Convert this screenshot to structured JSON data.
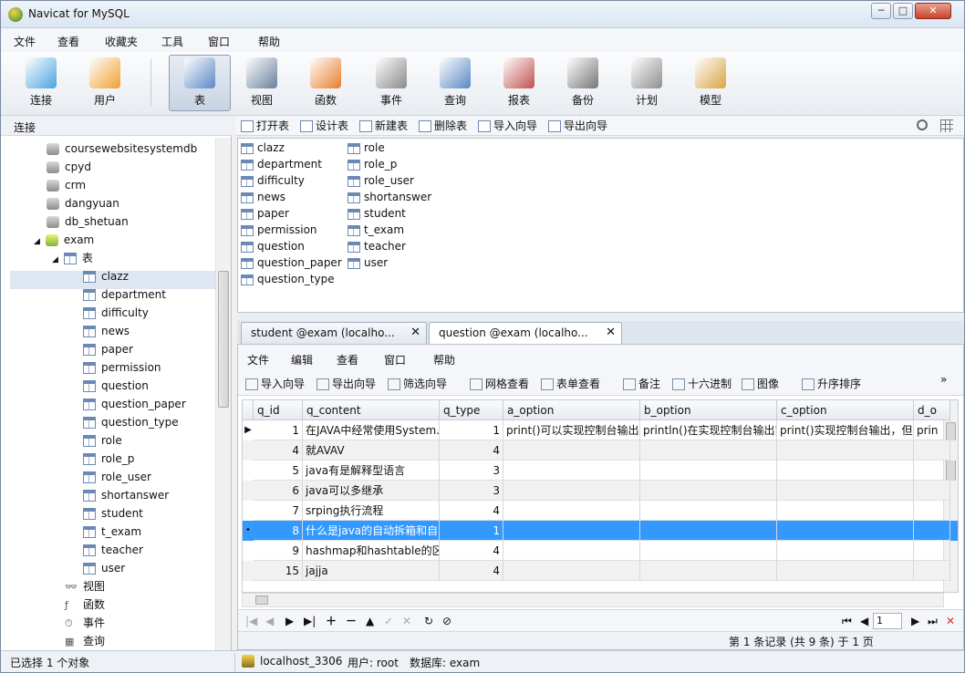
{
  "window": {
    "title": "Navicat for MySQL",
    "min": "─",
    "max": "□",
    "close": "✕"
  },
  "menu": [
    "文件",
    "查看",
    "收藏夹",
    "工具",
    "窗口",
    "帮助"
  ],
  "toolbar": [
    {
      "label": "连接",
      "icon": "connection-icon",
      "color": "#4aa3df"
    },
    {
      "label": "用户",
      "icon": "user-icon",
      "color": "#f0a030"
    },
    {
      "label": "表",
      "icon": "table-icon",
      "color": "#5b87c5",
      "active": true
    },
    {
      "label": "视图",
      "icon": "view-icon",
      "color": "#6a7f9c"
    },
    {
      "label": "函数",
      "icon": "function-icon",
      "color": "#e87d2a"
    },
    {
      "label": "事件",
      "icon": "event-icon",
      "color": "#8a8a8a"
    },
    {
      "label": "查询",
      "icon": "query-icon",
      "color": "#5b87c5"
    },
    {
      "label": "报表",
      "icon": "report-icon",
      "color": "#c0504d"
    },
    {
      "label": "备份",
      "icon": "backup-icon",
      "color": "#777777"
    },
    {
      "label": "计划",
      "icon": "schedule-icon",
      "color": "#8f8f8f"
    },
    {
      "label": "模型",
      "icon": "model-icon",
      "color": "#d9a441"
    }
  ],
  "left_panel": {
    "header": "连接"
  },
  "tree": {
    "databases": [
      "coursewebsitesystemdb",
      "cpyd",
      "crm",
      "dangyuan",
      "db_shetuan"
    ],
    "open_db": "exam",
    "tables_node": "表",
    "tables": [
      "clazz",
      "department",
      "difficulty",
      "news",
      "paper",
      "permission",
      "question",
      "question_paper",
      "question_type",
      "role",
      "role_p",
      "role_user",
      "shortanswer",
      "student",
      "t_exam",
      "teacher",
      "user"
    ],
    "other_nodes": [
      "视图",
      "函数",
      "事件",
      "查询"
    ]
  },
  "object_toolbar": [
    "打开表",
    "设计表",
    "新建表",
    "删除表",
    "导入向导",
    "导出向导"
  ],
  "object_list": {
    "col1": [
      "clazz",
      "department",
      "difficulty",
      "news",
      "paper",
      "permission",
      "question",
      "question_paper",
      "question_type"
    ],
    "col2": [
      "role",
      "role_p",
      "role_user",
      "shortanswer",
      "student",
      "t_exam",
      "teacher",
      "user"
    ]
  },
  "tabs": [
    {
      "label": "student @exam (localho...",
      "close": "✕"
    },
    {
      "label": "question @exam (localho...",
      "close": "✕",
      "active": true
    }
  ],
  "editor_menu": [
    "文件",
    "编辑",
    "查看",
    "窗口",
    "帮助"
  ],
  "editor_toolbar": [
    "导入向导",
    "导出向导",
    "筛选向导",
    "网格查看",
    "表单查看",
    "备注",
    "十六进制",
    "图像",
    "升序排序"
  ],
  "grid": {
    "columns": [
      "q_id",
      "q_content",
      "q_type",
      "a_option",
      "b_option",
      "c_option",
      "d_o"
    ],
    "rows": [
      [
        "1",
        "在JAVA中经常使用System.",
        "1",
        "print()可以实现控制台输出",
        "println()在实现控制台输出前",
        "print()实现控制台输出，但",
        "prin"
      ],
      [
        "4",
        "就AVAV",
        "4",
        "",
        "",
        "",
        ""
      ],
      [
        "5",
        "java有是解释型语言",
        "3",
        "",
        "",
        "",
        ""
      ],
      [
        "6",
        "java可以多继承",
        "3",
        "",
        "",
        "",
        ""
      ],
      [
        "7",
        "srping执行流程",
        "4",
        "",
        "",
        "",
        ""
      ],
      [
        "8",
        "什么是java的自动拆箱和自:",
        "1",
        "",
        "",
        "",
        ""
      ],
      [
        "9",
        "hashmap和hashtable的区",
        "4",
        "",
        "",
        "",
        ""
      ],
      [
        "15",
        "jajja",
        "4",
        "",
        "",
        "",
        ""
      ]
    ],
    "current_row": 0,
    "selected_row": 5
  },
  "nav": {
    "page": "1",
    "record_text": "第 1 条记录 (共 9 条) 于 1 页"
  },
  "status": {
    "selection": "已选择 1 个对象",
    "connection": "localhost_3306",
    "user": "用户: root",
    "database": "数据库: exam"
  }
}
